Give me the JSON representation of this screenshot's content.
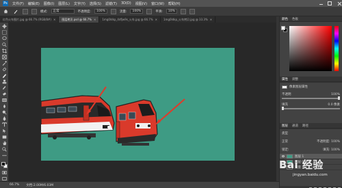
{
  "menubar": {
    "logo": "Ps",
    "items": [
      "文件(F)",
      "编辑(E)",
      "图像(I)",
      "图层(L)",
      "文字(Y)",
      "选择(S)",
      "滤镜(T)",
      "3D(D)",
      "视图(V)",
      "窗口(W)",
      "帮助(H)"
    ]
  },
  "options": {
    "mode_label": "模式:",
    "mode_value": "正常",
    "opacity_label": "不透明度:",
    "opacity_value": "100%",
    "flow_label": "流量:",
    "flow_value": "100%",
    "smooth_label": "平滑:",
    "smooth_value": "10%"
  },
  "tabs": [
    {
      "label": "红色火车图片.jpg @ 66.7% (RGB/8#)",
      "active": false
    },
    {
      "label": "图层拷贝.psd @ 66.7%",
      "active": true
    },
    {
      "label": "1mg0ldkp_4dfjw9s_火车.jpg @ 66.7%",
      "active": false
    },
    {
      "label": "1mg0ldkp_火车拷贝.jpg @ 33.3%",
      "active": false
    }
  ],
  "status": {
    "zoom": "66.7%",
    "doc": "文档:2.00M/6.03M"
  },
  "color_panel": {
    "tabs": [
      "颜色",
      "色板"
    ],
    "hue_color": "#ff0000"
  },
  "properties_panel": {
    "tabs": [
      "属性",
      "调整"
    ],
    "layer_label": "像素图层属性",
    "opacity_label": "不透明",
    "opacity_value": "100%",
    "fill_label": "填充",
    "fill_value": "0.0 像素"
  },
  "layers_panel": {
    "tabs": [
      "图层",
      "通道",
      "路径"
    ],
    "kind_label": "类型",
    "blend_mode": "正常",
    "opacity_label": "不透明度:",
    "opacity_value": "100%",
    "lock_label": "锁定:",
    "fill_label": "填充:",
    "fill_value": "100%",
    "layers": [
      {
        "name": "图层 1",
        "active": true
      },
      {
        "name": "图层 0 拷贝",
        "active": false
      },
      {
        "name": "背景",
        "active": false
      }
    ]
  },
  "watermark": {
    "text": "Bai 经验",
    "url": "jingyan.baidu.com"
  },
  "colors": {
    "canvas_bg": "#3e9b84",
    "train_red": "#d93a2b",
    "arrow_red": "#e03a2a"
  }
}
